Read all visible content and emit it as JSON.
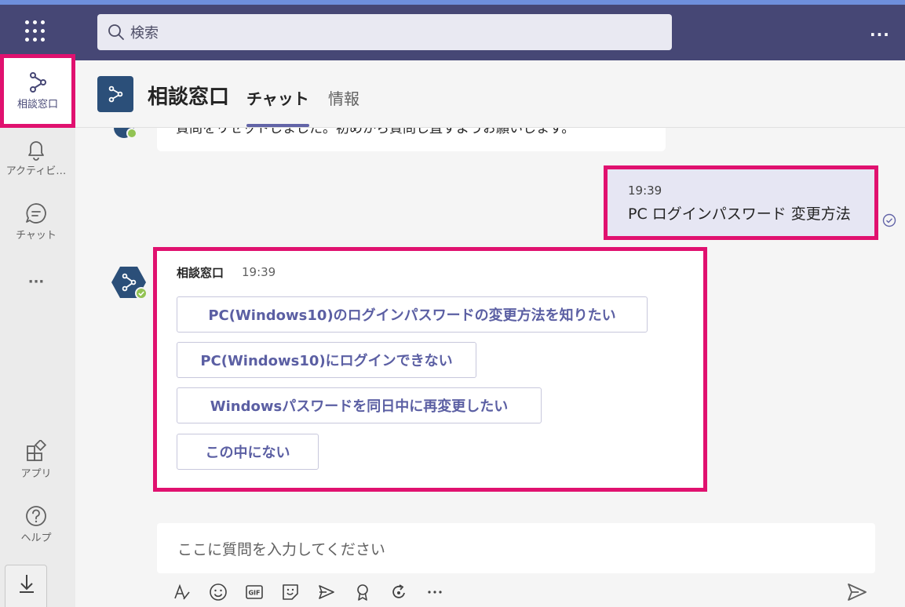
{
  "topbar": {
    "search_placeholder": "検索",
    "more_label": "···"
  },
  "rail": {
    "items": [
      {
        "label": "相談窓口",
        "icon": "bot-icon"
      },
      {
        "label": "アクティビ…",
        "icon": "bell-icon"
      },
      {
        "label": "チャット",
        "icon": "chat-icon"
      },
      {
        "label": "···",
        "icon": "more-icon"
      },
      {
        "label": "アプリ",
        "icon": "apps-icon"
      },
      {
        "label": "ヘルプ",
        "icon": "help-icon"
      }
    ],
    "download_icon": "download-icon"
  },
  "header": {
    "title": "相談窓口",
    "tabs": [
      {
        "label": "チャット",
        "active": true
      },
      {
        "label": "情報",
        "active": false
      }
    ]
  },
  "conversation": {
    "prev_message_text": "質問をリセットしました。初めから質問し直すようお願いします。",
    "sent_message": {
      "time": "19:39",
      "text": "PC ログインパスワード 変更方法"
    },
    "bot_message": {
      "sender": "相談窓口",
      "time": "19:39",
      "choices": [
        "PC(Windows10)のログインパスワードの変更方法を知りたい",
        "PC(Windows10)にログインできない",
        "Windowsパスワードを同日中に再変更したい",
        "この中にない"
      ]
    }
  },
  "composer": {
    "placeholder": "ここに質問を入力してください",
    "toolbar_icons": [
      "format-icon",
      "emoji-icon",
      "gif-icon",
      "sticker-icon",
      "meet-icon",
      "praise-icon",
      "loop-icon",
      "more-icon"
    ]
  },
  "colors": {
    "accent": "#6264a7",
    "topbar": "#464775",
    "highlight": "#e0116f",
    "bot_tile": "#2b4f79"
  }
}
